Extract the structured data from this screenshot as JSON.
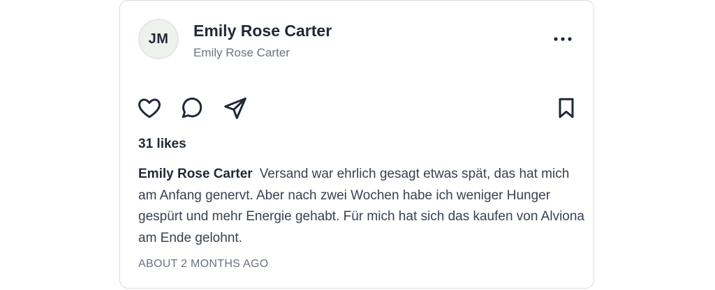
{
  "post": {
    "avatar_initials": "JM",
    "author_name": "Emily Rose Carter",
    "author_subtitle": "Emily Rose Carter",
    "more_icon": "more-horizontal-icon",
    "actions": {
      "like_icon": "heart-icon",
      "comment_icon": "comment-icon",
      "share_icon": "send-icon",
      "save_icon": "bookmark-icon"
    },
    "likes_text": "31 likes",
    "caption_author": "Emily Rose Carter",
    "caption_text": "Versand war ehrlich gesagt etwas spät, das hat mich am Anfang genervt. Aber nach zwei Wochen habe ich weniger Hunger gespürt und mehr Energie gehabt. Für mich hat sich das kaufen von Alviona am Ende gelohnt.",
    "timestamp": "ABOUT 2 MONTHS AGO"
  },
  "colors": {
    "text_primary": "#1f2937",
    "text_secondary": "#6b7280",
    "border": "#dbdbdb",
    "avatar_bg": "#eef2ec"
  }
}
